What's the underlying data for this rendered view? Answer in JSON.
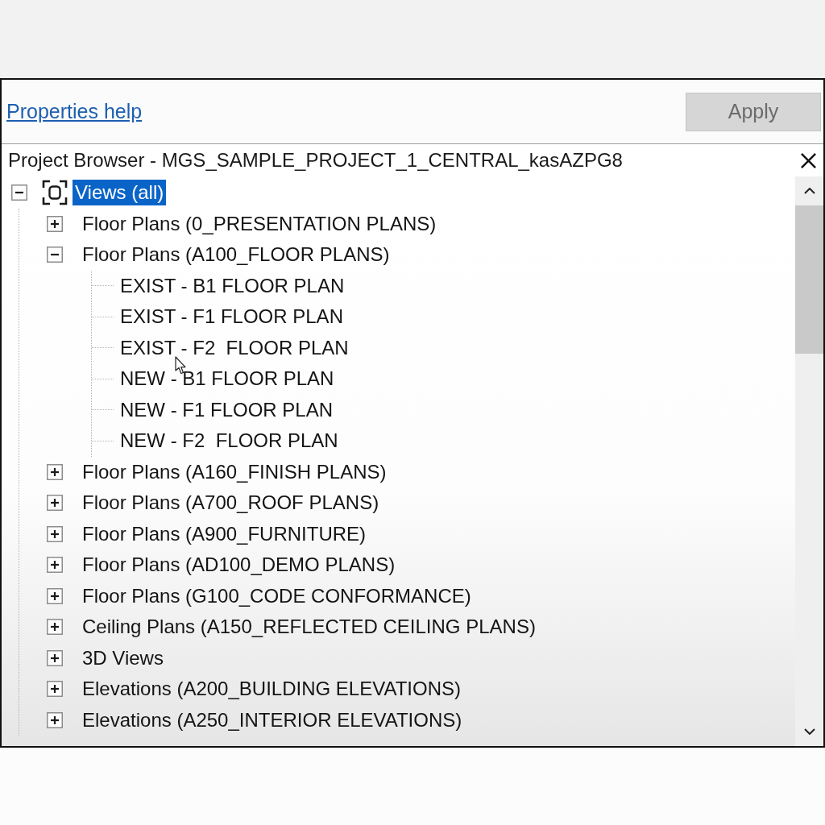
{
  "properties": {
    "help_link": "Properties help",
    "apply_button": {
      "label": "Apply",
      "disabled": true
    }
  },
  "project_browser": {
    "title": "Project Browser - MGS_SAMPLE_PROJECT_1_CENTRAL_kasAZPG8",
    "tree": [
      {
        "label": "Views (all)",
        "selected": true,
        "expanded": true,
        "children": [
          {
            "label": "Floor Plans (0_PRESENTATION PLANS)",
            "selected": false,
            "expanded": false
          },
          {
            "label": "Floor Plans (A100_FLOOR PLANS)",
            "selected": false,
            "expanded": true,
            "children": [
              {
                "label": "EXIST - B1 FLOOR PLAN",
                "selected": false
              },
              {
                "label": "EXIST - F1 FLOOR PLAN",
                "selected": false
              },
              {
                "label": "EXIST - F2  FLOOR PLAN",
                "selected": false
              },
              {
                "label": "NEW - B1 FLOOR PLAN",
                "selected": false
              },
              {
                "label": "NEW - F1 FLOOR PLAN",
                "selected": false
              },
              {
                "label": "NEW - F2  FLOOR PLAN",
                "selected": false
              }
            ]
          },
          {
            "label": "Floor Plans (A160_FINISH PLANS)",
            "selected": false,
            "expanded": false
          },
          {
            "label": "Floor Plans (A700_ROOF PLANS)",
            "selected": false,
            "expanded": false
          },
          {
            "label": "Floor Plans (A900_FURNITURE)",
            "selected": false,
            "expanded": false
          },
          {
            "label": "Floor Plans (AD100_DEMO PLANS)",
            "selected": false,
            "expanded": false
          },
          {
            "label": "Floor Plans (G100_CODE CONFORMANCE)",
            "selected": false,
            "expanded": false
          },
          {
            "label": "Ceiling Plans (A150_REFLECTED CEILING PLANS)",
            "selected": false,
            "expanded": false
          },
          {
            "label": "3D Views",
            "selected": false,
            "expanded": false
          },
          {
            "label": "Elevations (A200_BUILDING ELEVATIONS)",
            "selected": false,
            "expanded": false
          },
          {
            "label": "Elevations (A250_INTERIOR ELEVATIONS)",
            "selected": false,
            "expanded": false
          }
        ]
      }
    ]
  }
}
